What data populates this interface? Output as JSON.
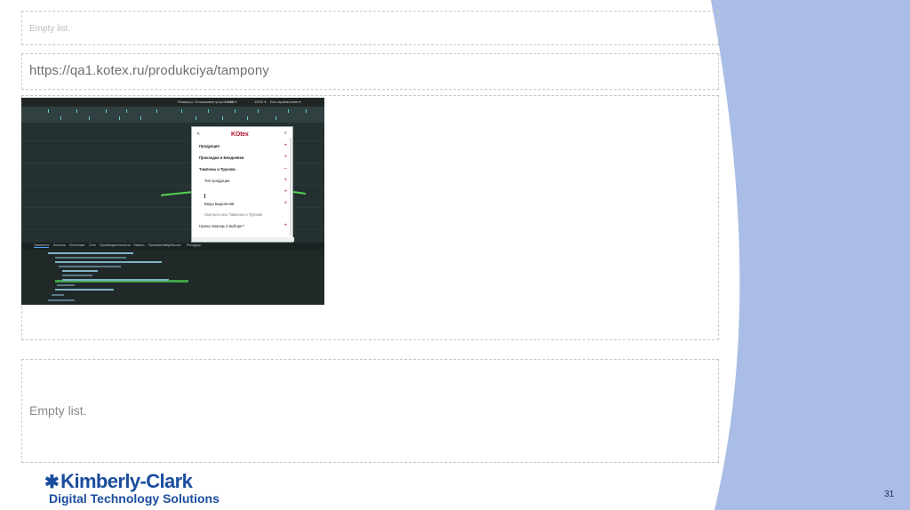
{
  "slide": {
    "top_placeholder": "Empty list.",
    "url": "https://qa1.kotex.ru/produkciya/tampony",
    "bottom_placeholder": "Empty list.",
    "page_number": "31"
  },
  "screenshot": {
    "toolbar_left": "Размеры: Отзывчивое устройство ▾",
    "toolbar_mid": "425",
    "toolbar_zoom": "100% ▾",
    "toolbar_right": "Без ограничения ▾",
    "menu_logo": "KOtex",
    "menu_items": [
      {
        "label": "Продукция",
        "sign": "+",
        "style": "bold"
      },
      {
        "label": "Прокладки и Ежедневки",
        "sign": "+",
        "style": "bold"
      },
      {
        "label": "Тампоны и Трусики",
        "sign": "–",
        "style": "bold"
      },
      {
        "label": "Тип продукции",
        "sign": "+",
        "style": "normal"
      },
      {
        "label": "",
        "sign": "+",
        "style": "normal"
      },
      {
        "label": "Виды выделений",
        "sign": "+",
        "style": "normal"
      },
      {
        "label": "Смотреть все Тампоны и Трусики",
        "sign": "",
        "style": "muted"
      },
      {
        "label": "Нужна помощь в выборе?",
        "sign": "+",
        "style": "normal"
      }
    ],
    "devtools_tabs": [
      "Элементы",
      "Консоль",
      "Источники",
      "Сеть",
      "Производительность",
      "Память",
      "Приложение",
      "Lighthouse",
      "Рекордер"
    ]
  },
  "brand": {
    "company": "Kimberly-Clark",
    "subtitle": "Digital Technology Solutions",
    "color": "#1a4d9e",
    "band_color": "#a9bde6"
  }
}
